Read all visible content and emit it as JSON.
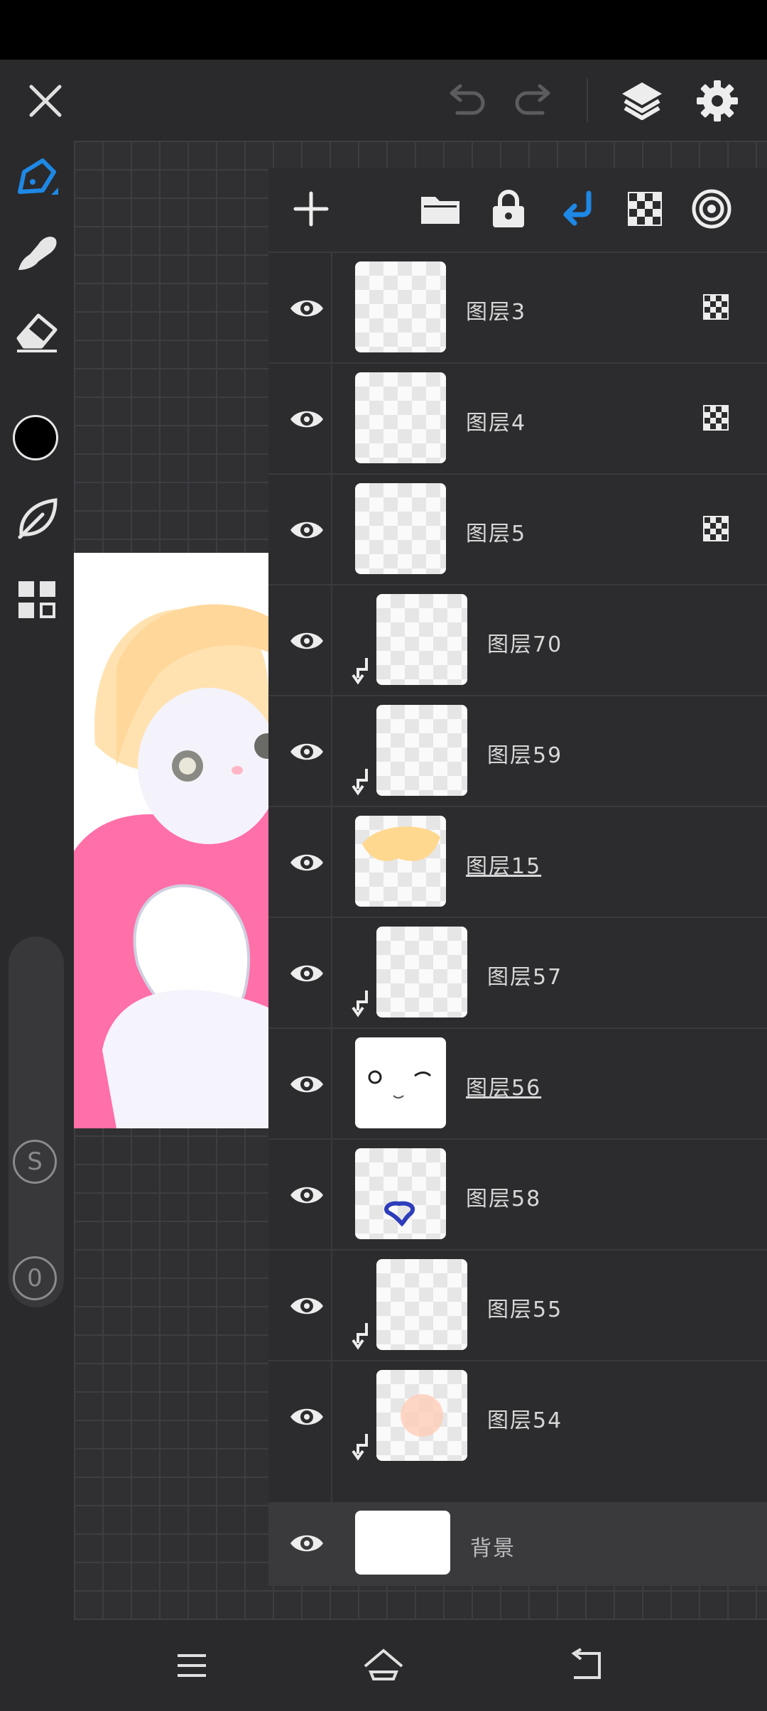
{
  "app": {
    "accent_color": "#1e88e5",
    "current_color": "#000000"
  },
  "topbar": {
    "close_icon": "close-icon",
    "undo_icon": "undo-icon",
    "redo_icon": "redo-icon",
    "layers_icon": "layers-icon",
    "settings_icon": "gear-icon"
  },
  "left_tools": {
    "items": [
      "pen-tool-icon",
      "smudge-tool-icon",
      "eraser-tool-icon",
      "color-swatch",
      "leaf-brush-icon",
      "grid-menu-icon"
    ],
    "size_label": "S",
    "opacity_label": "0"
  },
  "layer_panel": {
    "toolbar": [
      "add-layer-icon",
      "folder-icon",
      "lock-icon",
      "clip-mask-icon",
      "alpha-lock-icon",
      "blend-mode-icon"
    ],
    "layers": [
      {
        "name": "图层3",
        "clipped": false,
        "alpha_locked": true,
        "underlined": false
      },
      {
        "name": "图层4",
        "clipped": false,
        "alpha_locked": true,
        "underlined": false
      },
      {
        "name": "图层5",
        "clipped": false,
        "alpha_locked": true,
        "underlined": false
      },
      {
        "name": "图层70",
        "clipped": true,
        "alpha_locked": false,
        "underlined": false
      },
      {
        "name": "图层59",
        "clipped": true,
        "alpha_locked": false,
        "underlined": false
      },
      {
        "name": "图层15",
        "clipped": false,
        "alpha_locked": false,
        "underlined": true
      },
      {
        "name": "图层57",
        "clipped": true,
        "alpha_locked": false,
        "underlined": false
      },
      {
        "name": "图层56",
        "clipped": false,
        "alpha_locked": false,
        "underlined": true
      },
      {
        "name": "图层58",
        "clipped": false,
        "alpha_locked": false,
        "underlined": false
      },
      {
        "name": "图层55",
        "clipped": true,
        "alpha_locked": false,
        "underlined": false
      },
      {
        "name": "图层54",
        "clipped": true,
        "alpha_locked": false,
        "underlined": false
      }
    ],
    "background_layer": {
      "name": "背景"
    }
  },
  "navbar": {
    "items": [
      "menu-icon",
      "home-icon",
      "back-icon"
    ]
  }
}
